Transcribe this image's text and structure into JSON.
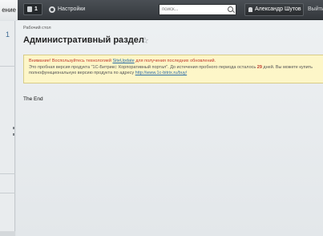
{
  "topbar": {
    "tab_label": "ение",
    "notifications_count": "1",
    "settings_label": "Настройки",
    "search_placeholder": "поиск...",
    "user_name": "Александр Шутов",
    "logout_label": "Выйти"
  },
  "leftmenu": {
    "item_badge": "1"
  },
  "main": {
    "breadcrumb": "Рабочий стол",
    "title": "Административный раздел",
    "notice": {
      "line1_prefix": "Внимание! Воспользуйтесь технологией ",
      "line1_link": "SiteUpdate",
      "line1_suffix": " для получения последних обновлений.",
      "line2_prefix": "Это пробная версия продукта \"1С-Битрикс: Корпоративный портал\". До истечения пробного периода осталось ",
      "days": "29",
      "line2_suffix": " дней. Вы можете купить",
      "line3_prefix": "полнофункциональную версию продукта по адресу ",
      "line3_link": "http://www.1c-bitrix.ru/buy/"
    },
    "footer_text": "The End"
  }
}
